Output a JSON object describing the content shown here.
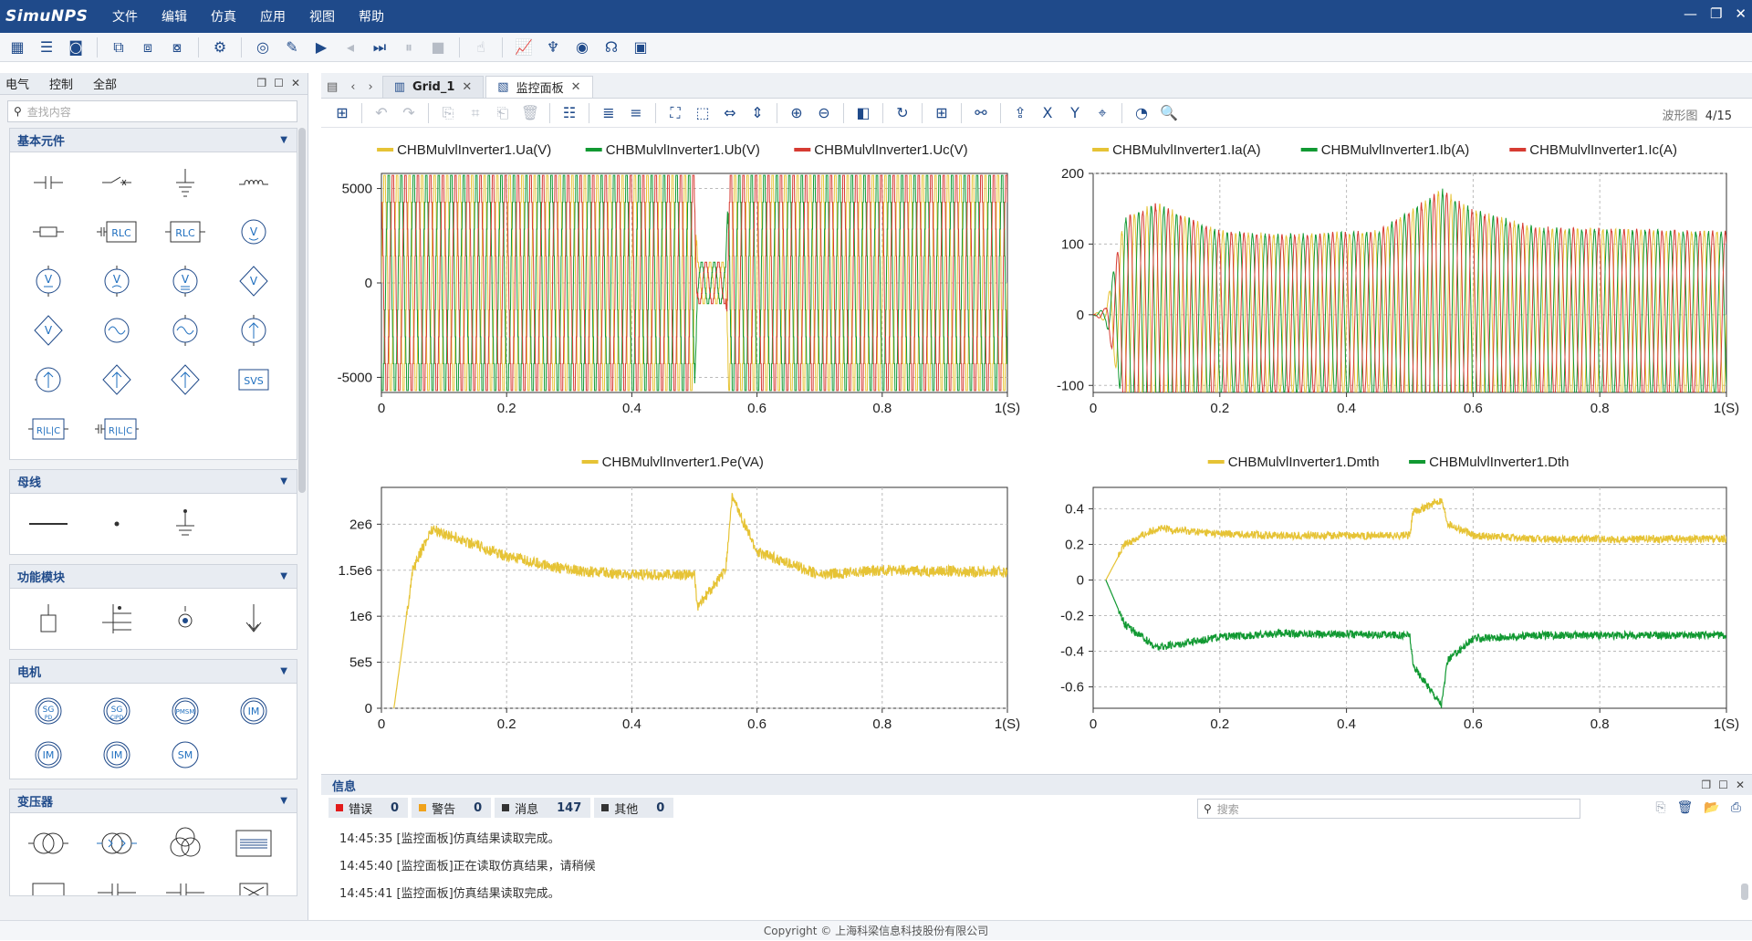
{
  "app": {
    "logo": "SimuNPS",
    "menu": [
      "文件",
      "编辑",
      "仿真",
      "应用",
      "视图",
      "帮助"
    ]
  },
  "window_controls": [
    "—",
    "❐",
    "✕"
  ],
  "left_panel": {
    "tabs": [
      "电气",
      "控制",
      "全部"
    ],
    "search_placeholder": "查找内容",
    "groups": [
      {
        "title": "基本元件"
      },
      {
        "title": "母线"
      },
      {
        "title": "功能模块"
      },
      {
        "title": "电机",
        "labels": [
          "SG PD",
          "SG CIPD",
          "PMSM",
          "IM",
          "IM",
          "IM",
          "SM"
        ]
      },
      {
        "title": "变压器"
      }
    ],
    "symbols": {
      "rlc": "RLC",
      "svs": "SVS",
      "v": "V"
    }
  },
  "editor": {
    "tabs": [
      {
        "label": "Grid_1",
        "icon": "grid-icon"
      },
      {
        "label": "监控面板",
        "icon": "monitor-icon"
      }
    ],
    "page_label": "波形图",
    "page_index": "4/15"
  },
  "plots": [
    {
      "legend": [
        "CHBMulvlInverter1.Ua(V)",
        "CHBMulvlInverter1.Ub(V)",
        "CHBMulvlInverter1.Uc(V)"
      ],
      "colors": [
        "#e6c335",
        "#119932",
        "#d63b32"
      ],
      "yticks": [
        "5000",
        "0",
        "-5000"
      ],
      "xticks": [
        "0",
        "0.2",
        "0.4",
        "0.6",
        "0.8",
        "1(S)"
      ]
    },
    {
      "legend": [
        "CHBMulvlInverter1.Ia(A)",
        "CHBMulvlInverter1.Ib(A)",
        "CHBMulvlInverter1.Ic(A)"
      ],
      "colors": [
        "#e6c335",
        "#119932",
        "#d63b32"
      ],
      "yticks": [
        "200",
        "100",
        "0",
        "-100"
      ],
      "xticks": [
        "0",
        "0.2",
        "0.4",
        "0.6",
        "0.8",
        "1(S)"
      ]
    },
    {
      "legend": [
        "CHBMulvlInverter1.Pe(VA)"
      ],
      "colors": [
        "#e6c335"
      ],
      "yticks": [
        "2e6",
        "1.5e6",
        "1e6",
        "5e5",
        "0"
      ],
      "xticks": [
        "0",
        "0.2",
        "0.4",
        "0.6",
        "0.8",
        "1(S)"
      ]
    },
    {
      "legend": [
        "CHBMulvlInverter1.Dmth",
        "CHBMulvlInverter1.Dth"
      ],
      "colors": [
        "#e6c335",
        "#119932"
      ],
      "yticks": [
        "0.4",
        "0.2",
        "0",
        "-0.2",
        "-0.4",
        "-0.6"
      ],
      "xticks": [
        "0",
        "0.2",
        "0.4",
        "0.6",
        "0.8",
        "1(S)"
      ]
    }
  ],
  "chart_data": [
    {
      "type": "line",
      "x_range": [
        0,
        1
      ],
      "y_range": [
        -5800,
        5800
      ],
      "series": [
        {
          "name": "CHBMulvlInverter1.Ua(V)"
        },
        {
          "name": "CHBMulvlInverter1.Ub(V)"
        },
        {
          "name": "CHBMulvlInverter1.Uc(V)"
        }
      ],
      "amplitude_key_points": [
        [
          0,
          5700
        ],
        [
          0.5,
          5700
        ],
        [
          0.505,
          1100
        ],
        [
          0.55,
          1100
        ],
        [
          0.555,
          5700
        ],
        [
          1,
          5700
        ]
      ]
    },
    {
      "type": "line",
      "x_range": [
        0,
        1
      ],
      "y_range": [
        -110,
        200
      ],
      "series": [
        {
          "name": "CHBMulvlInverter1.Ia(A)"
        },
        {
          "name": "CHBMulvlInverter1.Ib(A)"
        },
        {
          "name": "CHBMulvlInverter1.Ic(A)"
        }
      ],
      "amplitude_key_points": [
        [
          0,
          0
        ],
        [
          0.02,
          10
        ],
        [
          0.05,
          140
        ],
        [
          0.1,
          160
        ],
        [
          0.2,
          120
        ],
        [
          0.3,
          115
        ],
        [
          0.45,
          120
        ],
        [
          0.55,
          180
        ],
        [
          0.6,
          150
        ],
        [
          0.7,
          125
        ],
        [
          1,
          120
        ]
      ]
    },
    {
      "type": "line",
      "x_range": [
        0,
        1
      ],
      "y_range": [
        0,
        2400000
      ],
      "series": [
        {
          "name": "CHBMulvlInverter1.Pe(VA)",
          "points": [
            [
              0.02,
              0
            ],
            [
              0.03,
              500000
            ],
            [
              0.05,
              1500000
            ],
            [
              0.08,
              1950000
            ],
            [
              0.12,
              1850000
            ],
            [
              0.2,
              1650000
            ],
            [
              0.3,
              1500000
            ],
            [
              0.4,
              1450000
            ],
            [
              0.5,
              1450000
            ],
            [
              0.505,
              1100000
            ],
            [
              0.55,
              1500000
            ],
            [
              0.56,
              2300000
            ],
            [
              0.6,
              1700000
            ],
            [
              0.7,
              1450000
            ],
            [
              0.8,
              1500000
            ],
            [
              1,
              1480000
            ]
          ]
        }
      ]
    },
    {
      "type": "line",
      "x_range": [
        0,
        1
      ],
      "y_range": [
        -0.72,
        0.52
      ],
      "series": [
        {
          "name": "CHBMulvlInverter1.Dmth",
          "points": [
            [
              0.02,
              0
            ],
            [
              0.05,
              0.2
            ],
            [
              0.1,
              0.29
            ],
            [
              0.2,
              0.26
            ],
            [
              0.3,
              0.25
            ],
            [
              0.5,
              0.25
            ],
            [
              0.505,
              0.38
            ],
            [
              0.55,
              0.45
            ],
            [
              0.56,
              0.32
            ],
            [
              0.6,
              0.25
            ],
            [
              0.7,
              0.23
            ],
            [
              1,
              0.23
            ]
          ]
        },
        {
          "name": "CHBMulvlInverter1.Dth",
          "points": [
            [
              0.02,
              0
            ],
            [
              0.05,
              -0.25
            ],
            [
              0.1,
              -0.38
            ],
            [
              0.2,
              -0.32
            ],
            [
              0.3,
              -0.3
            ],
            [
              0.5,
              -0.31
            ],
            [
              0.505,
              -0.48
            ],
            [
              0.55,
              -0.7
            ],
            [
              0.56,
              -0.45
            ],
            [
              0.6,
              -0.33
            ],
            [
              0.7,
              -0.31
            ],
            [
              1,
              -0.31
            ]
          ]
        }
      ]
    }
  ],
  "info_panel": {
    "title": "信息",
    "filters": [
      {
        "label": "错误",
        "count": "0",
        "color": "#e21b1b"
      },
      {
        "label": "警告",
        "count": "0",
        "color": "#f0a21a"
      },
      {
        "label": "消息",
        "count": "147",
        "color": "#333333"
      },
      {
        "label": "其他",
        "count": "0",
        "color": "#333333"
      }
    ],
    "search_placeholder": "搜索",
    "logs": [
      "14:45:35 [监控面板]仿真结果读取完成。",
      "14:45:40 [监控面板]正在读取仿真结果，请稍候",
      "14:45:41 [监控面板]仿真结果读取完成。"
    ]
  },
  "footer": "Copyright © 上海科梁信息科技股份有限公司"
}
